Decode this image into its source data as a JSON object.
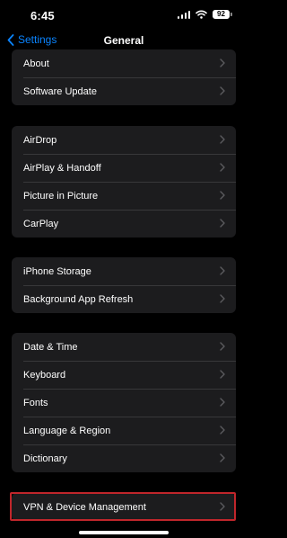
{
  "status_bar": {
    "time": "6:45",
    "battery": "92"
  },
  "nav": {
    "back_label": "Settings",
    "title": "General"
  },
  "groups": [
    {
      "items": [
        {
          "label": "About"
        },
        {
          "label": "Software Update"
        }
      ]
    },
    {
      "items": [
        {
          "label": "AirDrop"
        },
        {
          "label": "AirPlay & Handoff"
        },
        {
          "label": "Picture in Picture"
        },
        {
          "label": "CarPlay"
        }
      ]
    },
    {
      "items": [
        {
          "label": "iPhone Storage"
        },
        {
          "label": "Background App Refresh"
        }
      ]
    },
    {
      "items": [
        {
          "label": "Date & Time"
        },
        {
          "label": "Keyboard"
        },
        {
          "label": "Fonts"
        },
        {
          "label": "Language & Region"
        },
        {
          "label": "Dictionary"
        }
      ]
    },
    {
      "items": [
        {
          "label": "VPN & Device Management"
        }
      ]
    }
  ],
  "colors": {
    "accent": "#0a84ff",
    "group_bg": "#1c1c1e",
    "highlight": "#c0262b"
  }
}
